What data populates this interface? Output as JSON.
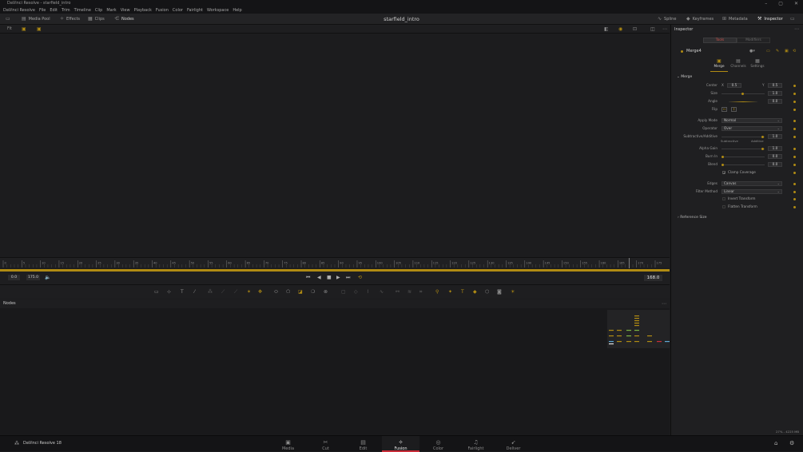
{
  "window": {
    "title": "DaVinci Resolve - starfield_intro",
    "controls": [
      "–",
      "▢",
      "✕"
    ]
  },
  "menu": [
    "DaVinci Resolve",
    "File",
    "Edit",
    "Trim",
    "Timeline",
    "Clip",
    "Mark",
    "View",
    "Playback",
    "Fusion",
    "Color",
    "Fairlight",
    "Workspace",
    "Help"
  ],
  "toolbar": {
    "media_pool": "Media Pool",
    "effects": "Effects",
    "clips": "Clips",
    "nodes": "Nodes",
    "project_title": "starfield_intro",
    "spline": "Spline",
    "keyframes": "Keyframes",
    "metadata": "Metadata",
    "inspector": "Inspector"
  },
  "viewer": {
    "zoom": "Fit"
  },
  "ruler": {
    "labels": [
      "0",
      "5",
      "10",
      "15",
      "20",
      "25",
      "30",
      "35",
      "40",
      "45",
      "50",
      "55",
      "60",
      "65",
      "70",
      "75",
      "80",
      "85",
      "90",
      "95",
      "100",
      "105",
      "110",
      "115",
      "120",
      "125",
      "130",
      "135",
      "140",
      "145",
      "150",
      "155",
      "160",
      "165",
      "170",
      "175"
    ]
  },
  "playback": {
    "start": "0.0",
    "end": "175.0",
    "current": "168.0"
  },
  "nodes": {
    "title": "Nodes"
  },
  "inspector": {
    "title": "Inspector",
    "tabs": [
      "Tools",
      "Modifiers"
    ],
    "node_name": "Merge4",
    "subtabs": [
      "Merge",
      "Channels",
      "Settings"
    ],
    "section": "Merge",
    "center_x_label": "X",
    "center_x": "0.5",
    "center_y_label": "Y",
    "center_y": "0.5",
    "center_label": "Center",
    "size_label": "Size",
    "size": "1.0",
    "angle_label": "Angle",
    "angle": "0.0",
    "flip_label": "Flip",
    "apply_mode_label": "Apply Mode",
    "apply_mode": "Normal",
    "operator_label": "Operator",
    "operator": "Over",
    "subadd_label": "Subtractive/Additive",
    "subadd": "1.0",
    "subtractive": "Subtractive",
    "additive": "Additive",
    "alpha_gain_label": "Alpha Gain",
    "alpha_gain": "1.0",
    "burn_in_label": "Burn In",
    "burn_in": "0.0",
    "blend_label": "Blend",
    "blend": "0.0",
    "clamp_coverage": "Clamp Coverage",
    "edges_label": "Edges",
    "edges": "Canvas",
    "filter_method_label": "Filter Method",
    "filter_method": "Linear",
    "invert_transform": "Invert Transform",
    "flatten_transform": "Flatten Transform",
    "reference_size": "Reference Size"
  },
  "status": {
    "memory": "27% - 4225 MB"
  },
  "bottom": {
    "app_name": "DaVinci Resolve 18",
    "pages": [
      "Media",
      "Cut",
      "Edit",
      "Fusion",
      "Color",
      "Fairlight",
      "Deliver"
    ],
    "active_page": "Fusion"
  },
  "colors": {
    "accent": "#b08b13",
    "active_page": "#c92d3a"
  }
}
